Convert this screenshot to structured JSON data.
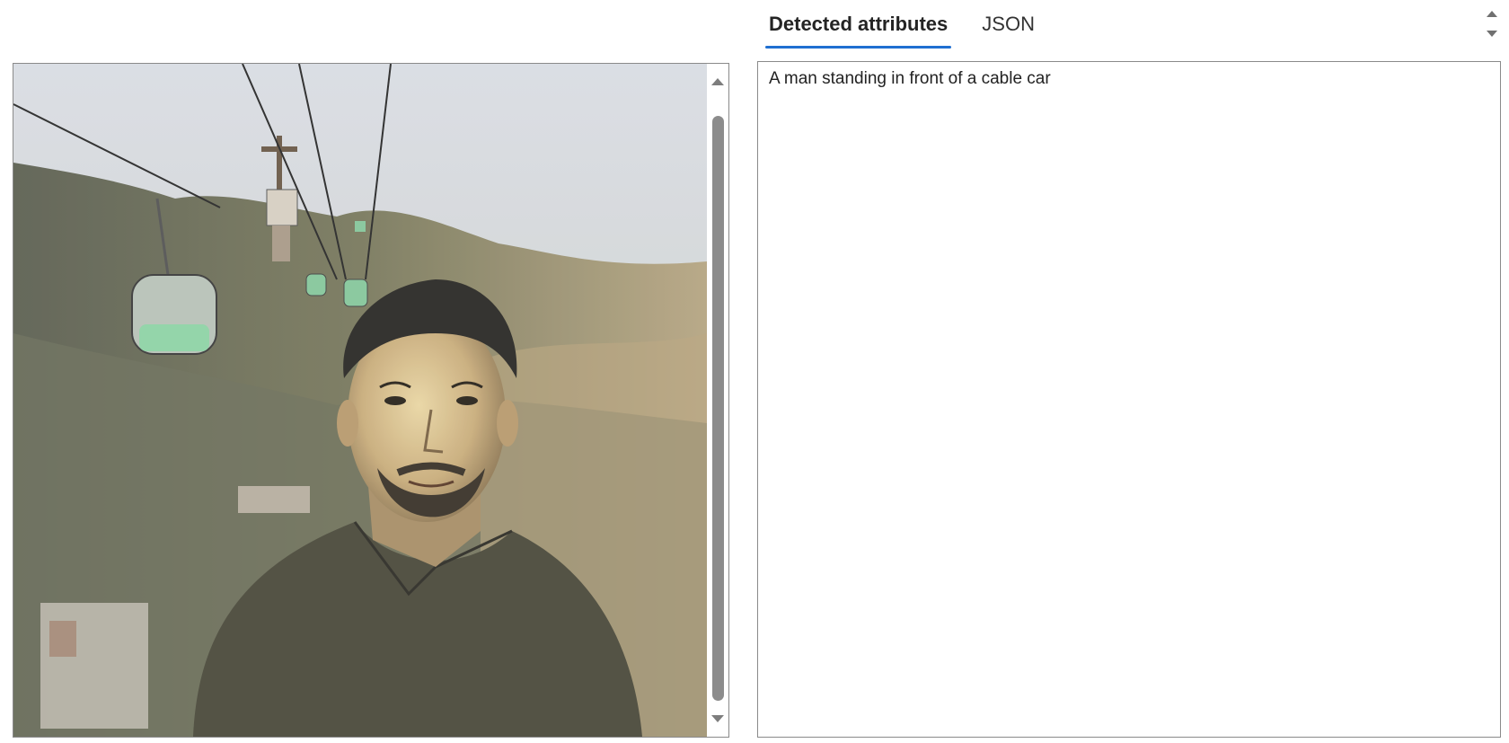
{
  "viewer": {
    "image_description_icon": "photo-of-man-with-cable-cars"
  },
  "tabs": [
    {
      "label": "Detected attributes",
      "active": true
    },
    {
      "label": "JSON",
      "active": false
    }
  ],
  "result": {
    "caption": "A man standing in front of a cable car"
  },
  "colors": {
    "accent": "#1f6fd1",
    "border": "#8a8a8a",
    "scroll_thumb": "#8c8c8c"
  }
}
